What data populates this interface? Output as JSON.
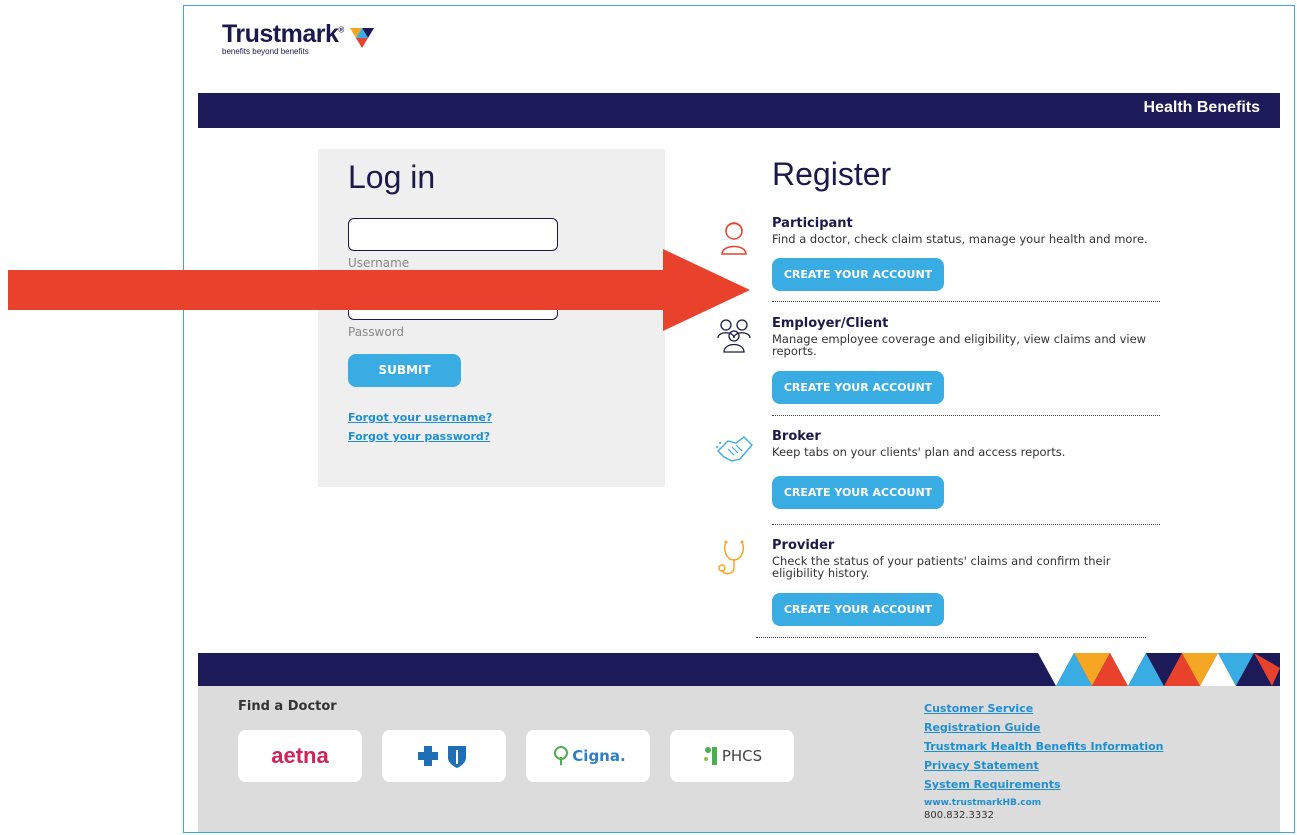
{
  "brand": {
    "name": "Trustmark",
    "tagline": "benefits beyond benefits"
  },
  "header": {
    "title": "Health Benefits"
  },
  "login": {
    "title": "Log in",
    "username_label": "Username",
    "password_label": "Password",
    "submit_label": "SUBMIT",
    "forgot_username": "Forgot your username?",
    "forgot_password": "Forgot your password?"
  },
  "register": {
    "title": "Register",
    "items": [
      {
        "name": "Participant",
        "desc": "Find a doctor, check claim status, manage your health and more.",
        "button": "CREATE YOUR ACCOUNT"
      },
      {
        "name": "Employer/Client",
        "desc": "Manage employee coverage and eligibility, view claims and view reports.",
        "button": "CREATE YOUR ACCOUNT"
      },
      {
        "name": "Broker",
        "desc": "Keep tabs on your clients' plan and access reports.",
        "button": "CREATE YOUR ACCOUNT"
      },
      {
        "name": "Provider",
        "desc": "Check the status of your patients' claims and confirm their eligibility history.",
        "button": "CREATE YOUR ACCOUNT"
      }
    ]
  },
  "footer": {
    "find_doctor": "Find a Doctor",
    "logos": {
      "aetna": "aetna",
      "cigna": "Cigna.",
      "phcs": "PHCS"
    },
    "links": [
      "Customer Service",
      "Registration Guide",
      "Trustmark Health Benefits Information",
      "Privacy Statement",
      "System Requirements"
    ],
    "website": "www.trustmarkHB.com",
    "phone": "800.832.3332"
  },
  "colors": {
    "navy": "#1c1a59",
    "accent_blue": "#3aace4",
    "link_blue": "#1f8fd0",
    "arrow_red": "#e8412c"
  }
}
